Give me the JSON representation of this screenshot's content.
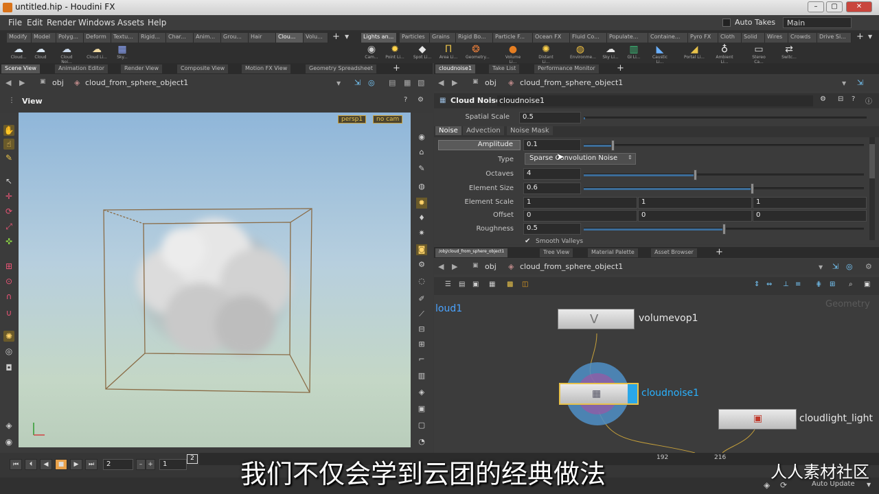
{
  "window": {
    "title": "untitled.hip - Houdini FX",
    "min": "–",
    "max": "▢",
    "close": "✕"
  },
  "menubar": {
    "items": [
      "File",
      "Edit",
      "Render",
      "Windows",
      "Assets",
      "Help"
    ],
    "auto_takes": "Auto Takes",
    "take": "Main"
  },
  "shelf_left": {
    "tabs": [
      "Modify",
      "Model",
      "Polyg...",
      "Deform",
      "Textu...",
      "Rigid...",
      "Char...",
      "Anim...",
      "Grou...",
      "Hair",
      "Clou...",
      "Volu..."
    ],
    "tools": [
      "Cloud...",
      "Cloud",
      "Cloud Noi...",
      "Cloud Li...",
      "Sky..."
    ]
  },
  "shelf_right": {
    "tabs": [
      "Lights an...",
      "Particles",
      "Grains",
      "Rigid Bo...",
      "Particle F...",
      "Ocean FX",
      "Fluid Co...",
      "Populate...",
      "Containe...",
      "Pyro FX",
      "Cloth",
      "Solid",
      "Wires",
      "Crowds",
      "Drive Si..."
    ],
    "tools": [
      "Cam...",
      "Point Li...",
      "Spot Li...",
      "Area Li...",
      "Geometry...",
      "Volume Li...",
      "Distant Li...",
      "Environme...",
      "Sky Li...",
      "GI Li...",
      "Caustic Li...",
      "Portal Li...",
      "Ambient Li...",
      "Stereo Ca...",
      "Switc..."
    ]
  },
  "viewer": {
    "tabs": [
      "Scene View",
      "Animation Editor",
      "Render View",
      "Composite View",
      "Motion FX View",
      "Geometry Spreadsheet"
    ],
    "path_root": "obj",
    "path_object": "cloud_from_sphere_object1",
    "header": "View",
    "persp": "persp1",
    "cam": "no cam"
  },
  "params": {
    "tabs": [
      "cloudnoise1",
      "Take List",
      "Performance Monitor"
    ],
    "path_root": "obj",
    "path_object": "cloud_from_sphere_object1",
    "node_type": "Cloud Noise",
    "node_name": "cloudnoise1",
    "spatial_scale_label": "Spatial Scale",
    "spatial_scale": "0.5",
    "subtabs": [
      "Noise",
      "Advection",
      "Noise Mask"
    ],
    "amplitude_label": "Amplitude",
    "amplitude": "0.1",
    "type_label": "Type",
    "type_value": "Sparse Convolution Noise",
    "octaves_label": "Octaves",
    "octaves": "4",
    "element_size_label": "Element Size",
    "element_size": "0.6",
    "element_scale_label": "Element Scale",
    "element_scale": [
      "1",
      "1",
      "1"
    ],
    "offset_label": "Offset",
    "offset": [
      "0",
      "0",
      "0"
    ],
    "roughness_label": "Roughness",
    "roughness": "0.5",
    "smooth_valleys": "Smooth Valleys"
  },
  "network": {
    "tabs": [
      "/obj/cloud_from_sphere_object1",
      "Tree View",
      "Material Palette",
      "Asset Browser"
    ],
    "path_root": "obj",
    "path_object": "cloud_from_sphere_object1",
    "context_label": "Geometry",
    "nodes": {
      "partial": "loud1",
      "vop": "volumevop1",
      "noise": "cloudnoise1",
      "light": "cloudlight_light"
    }
  },
  "timeline": {
    "frame": "2",
    "start": "1",
    "marker": "2",
    "ticks": [
      "192",
      "216"
    ],
    "auto_update": "Auto Update"
  },
  "overlay": {
    "subtitle": "我们不仅会学到云团的经典做法",
    "watermark": "人人素材社区"
  }
}
